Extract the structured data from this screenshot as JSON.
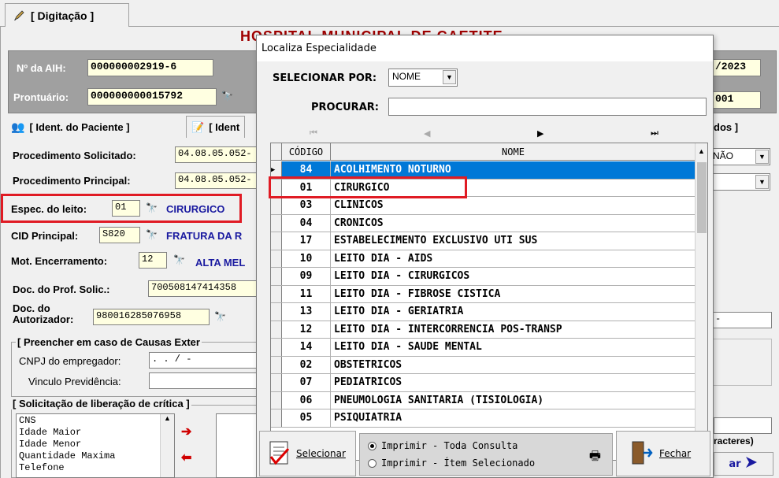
{
  "tabs": {
    "digitacao": "[ Digitação ]"
  },
  "header": {
    "hospital_title": "HOSPITAL MUNICIPAL DE CAETITE",
    "aih_label": "Nº da AIH:",
    "aih_value": "000000002919-6",
    "prontuario_label": "Prontuário:",
    "prontuario_value": "000000000015792",
    "date_fragment": "/2023",
    "right_fragment": "001"
  },
  "subtabs": {
    "ident_paciente": "[ Ident. do Paciente ]",
    "ident2": "[ Ident",
    "dados": "dos ]"
  },
  "form": {
    "proc_solicitado_label": "Procedimento Solicitado:",
    "proc_solicitado_value": "04.08.05.052-",
    "proc_principal_label": "Procedimento Principal:",
    "proc_principal_value": "04.08.05.052-",
    "espec_leito_label": "Espec. do leito:",
    "espec_leito_value": "01",
    "espec_leito_desc": "CIRURGICO",
    "cid_label": "CID Principal:",
    "cid_value": "S820",
    "cid_desc": "FRATURA DA R",
    "mot_label": "Mot. Encerramento:",
    "mot_value": "12",
    "mot_desc": "ALTA MEL",
    "doc_solic_label": "Doc. do Prof. Solic.:",
    "doc_solic_value": "700508147414358",
    "doc_aut_label_1": "Doc. do",
    "doc_aut_label_2": "Autorizador:",
    "doc_aut_value": "980016285076958",
    "combo_nao": "NÃO",
    "causas_title": "[ Preencher em caso de Causas Exter",
    "cnpj_label": "CNPJ do empregador:",
    "cnpj_value": ". . / -",
    "vinculo_label": "Vinculo Previdência:",
    "solic_title": "[ Solicitação de liberação de crítica ]",
    "critica_items": [
      "CNS",
      "Idade Maior",
      "Idade Menor",
      "Quantidade Maxima",
      "Telefone"
    ],
    "caracteres_frag": "racteres)",
    "avancar_frag": "ar"
  },
  "dialog": {
    "title": "Localiza Especialidade",
    "selecionar_label": "SELECIONAR POR:",
    "selecionar_value": "NOME",
    "procurar_label": "PROCURAR:",
    "procurar_value": "",
    "grid_headers": [
      "CÓDIGO",
      "NOME"
    ],
    "rows": [
      {
        "cod": "84",
        "nome": "ACOLHIMENTO NOTURNO"
      },
      {
        "cod": "01",
        "nome": "CIRURGICO"
      },
      {
        "cod": "03",
        "nome": "CLINICOS"
      },
      {
        "cod": "04",
        "nome": "CRONICOS"
      },
      {
        "cod": "17",
        "nome": "ESTABELECIMENTO EXCLUSIVO UTI SUS"
      },
      {
        "cod": "10",
        "nome": "LEITO DIA - AIDS"
      },
      {
        "cod": "09",
        "nome": "LEITO DIA - CIRURGICOS"
      },
      {
        "cod": "11",
        "nome": "LEITO DIA - FIBROSE CISTICA"
      },
      {
        "cod": "13",
        "nome": "LEITO DIA - GERIATRIA"
      },
      {
        "cod": "12",
        "nome": "LEITO DIA - INTERCORRENCIA POS-TRANSP"
      },
      {
        "cod": "14",
        "nome": "LEITO DIA - SAUDE MENTAL"
      },
      {
        "cod": "02",
        "nome": "OBSTETRICOS"
      },
      {
        "cod": "07",
        "nome": "PEDIATRICOS"
      },
      {
        "cod": "06",
        "nome": "PNEUMOLOGIA SANITARIA (TISIOLOGIA)"
      },
      {
        "cod": "05",
        "nome": "PSIQUIATRIA"
      }
    ],
    "selecionar_button": "Selecionar",
    "radio_toda": "Imprimir - Toda Consulta",
    "radio_item": "Imprimir - Ítem Selecionado",
    "fechar_button": "Fechar"
  },
  "colors": {
    "selection": "#0078d7",
    "highlight_border": "#e01b24",
    "link_blue": "#1a1aa0"
  }
}
